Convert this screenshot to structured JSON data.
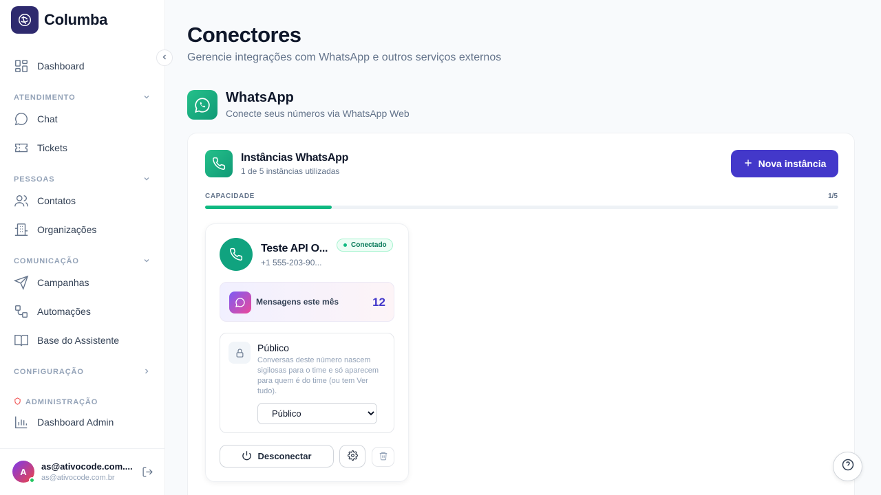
{
  "app": {
    "name": "Columba"
  },
  "sidebar": {
    "dashboard": "Dashboard",
    "sections": {
      "atendimento": "ATENDIMENTO",
      "pessoas": "PESSOAS",
      "comunicacao": "COMUNICAÇÃO",
      "configuracao": "CONFIGURAÇÃO",
      "administracao": "ADMINISTRAÇÃO"
    },
    "items": {
      "chat": "Chat",
      "tickets": "Tickets",
      "contatos": "Contatos",
      "organizacoes": "Organizações",
      "campanhas": "Campanhas",
      "automacoes": "Automações",
      "base_assistente": "Base do Assistente",
      "dashboard_admin": "Dashboard Admin"
    },
    "user": {
      "initial": "A",
      "name": "as@ativocode.com....",
      "email": "as@ativocode.com.br"
    }
  },
  "page": {
    "title": "Conectores",
    "subtitle": "Gerencie integrações com WhatsApp e outros serviços externos"
  },
  "whatsapp": {
    "title": "WhatsApp",
    "subtitle": "Conecte seus números via WhatsApp Web",
    "instances_title": "Instâncias WhatsApp",
    "instances_sub": "1 de 5 instâncias utilizadas",
    "new_button": "Nova instância",
    "capacity_label": "CAPACIDADE",
    "capacity_value": "1/5",
    "capacity_fraction": 0.2
  },
  "instance": {
    "name": "Teste API O...",
    "phone": "+1 555-203-90...",
    "status": "Conectado",
    "messages_label": "Mensagens este mês",
    "messages_count": "12",
    "visibility_title": "Público",
    "visibility_desc": "Conversas deste número nascem sigilosas para o time e só aparecem para quem é do time (ou tem Ver tudo).",
    "visibility_selected": "Público",
    "disconnect": "Desconectar"
  },
  "colors": {
    "primary": "#4338ca",
    "whatsapp": "#10a37f",
    "success": "#10b981"
  }
}
